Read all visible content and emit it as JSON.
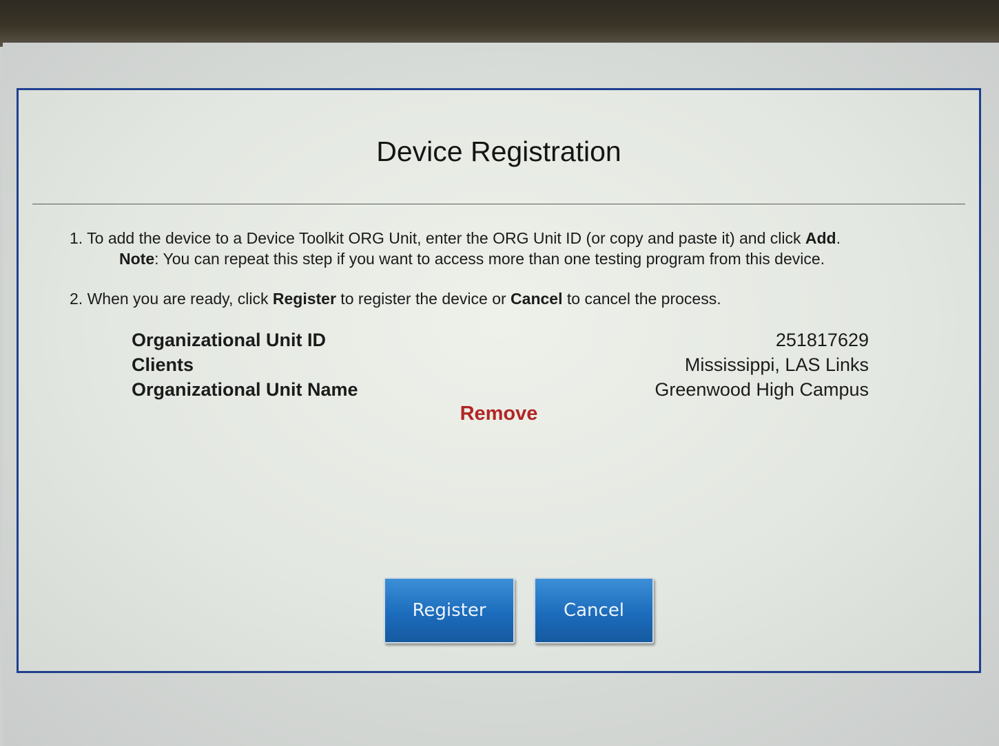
{
  "dialog": {
    "title": "Device Registration",
    "step1": {
      "prefix": "1. To add the device to a Device Toolkit ORG Unit, enter the ORG Unit ID (or copy and paste it) and click ",
      "bold": "Add",
      "suffix": "."
    },
    "note": {
      "bold": "Note",
      "text": ": You can repeat this step if you want to access more than one testing program from this device."
    },
    "step2": {
      "prefix": "2. When you are ready, click ",
      "bold1": "Register",
      "middle": " to register the device or ",
      "bold2": "Cancel",
      "suffix": " to cancel the process."
    },
    "info": {
      "org_unit_id_label": "Organizational Unit ID",
      "org_unit_id_value": "251817629",
      "clients_label": "Clients",
      "clients_value": "Mississippi, LAS Links",
      "org_unit_name_label": "Organizational Unit Name",
      "org_unit_name_value": "Greenwood High Campus"
    },
    "remove_label": "Remove",
    "register_label": "Register",
    "cancel_label": "Cancel",
    "colors": {
      "border": "#1f3f8f",
      "button": "#1c6cbc",
      "remove": "#b22525"
    }
  }
}
